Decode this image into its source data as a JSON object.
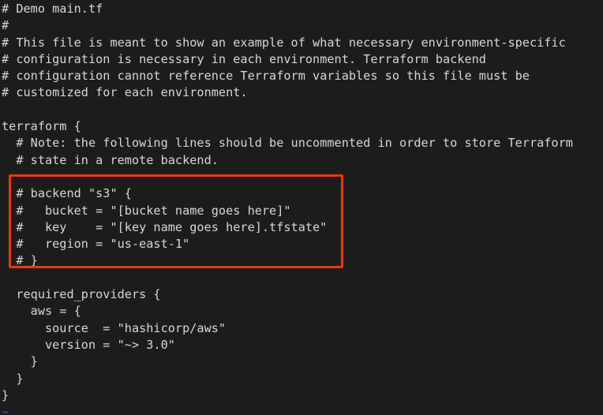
{
  "editor": {
    "file_name": "main.tf",
    "background_color": "#1c1c1c",
    "text_color": "#d8d8d8",
    "tilde_color": "#3465c4",
    "lines": [
      "# Demo main.tf",
      "#",
      "# This file is meant to show an example of what necessary environment-specific",
      "# configuration is necessary in each environment. Terraform backend",
      "# configuration cannot reference Terraform variables so this file must be",
      "# customized for each environment.",
      "",
      "terraform {",
      "  # Note: the following lines should be uncommented in order to store Terraform",
      "  # state in a remote backend.",
      "",
      "  # backend \"s3\" {",
      "  #   bucket = \"[bucket name goes here]\"",
      "  #   key    = \"[key name goes here].tfstate\"",
      "  #   region = \"us-east-1\"",
      "  # }",
      "",
      "  required_providers {",
      "    aws = {",
      "      source  = \"hashicorp/aws\"",
      "      version = \"~> 3.0\"",
      "    }",
      "  }",
      "}"
    ],
    "empty_line_markers": [
      "~"
    ]
  },
  "annotation": {
    "highlight_color": "#ee3611",
    "label": "backend-s3-block-highlight"
  }
}
